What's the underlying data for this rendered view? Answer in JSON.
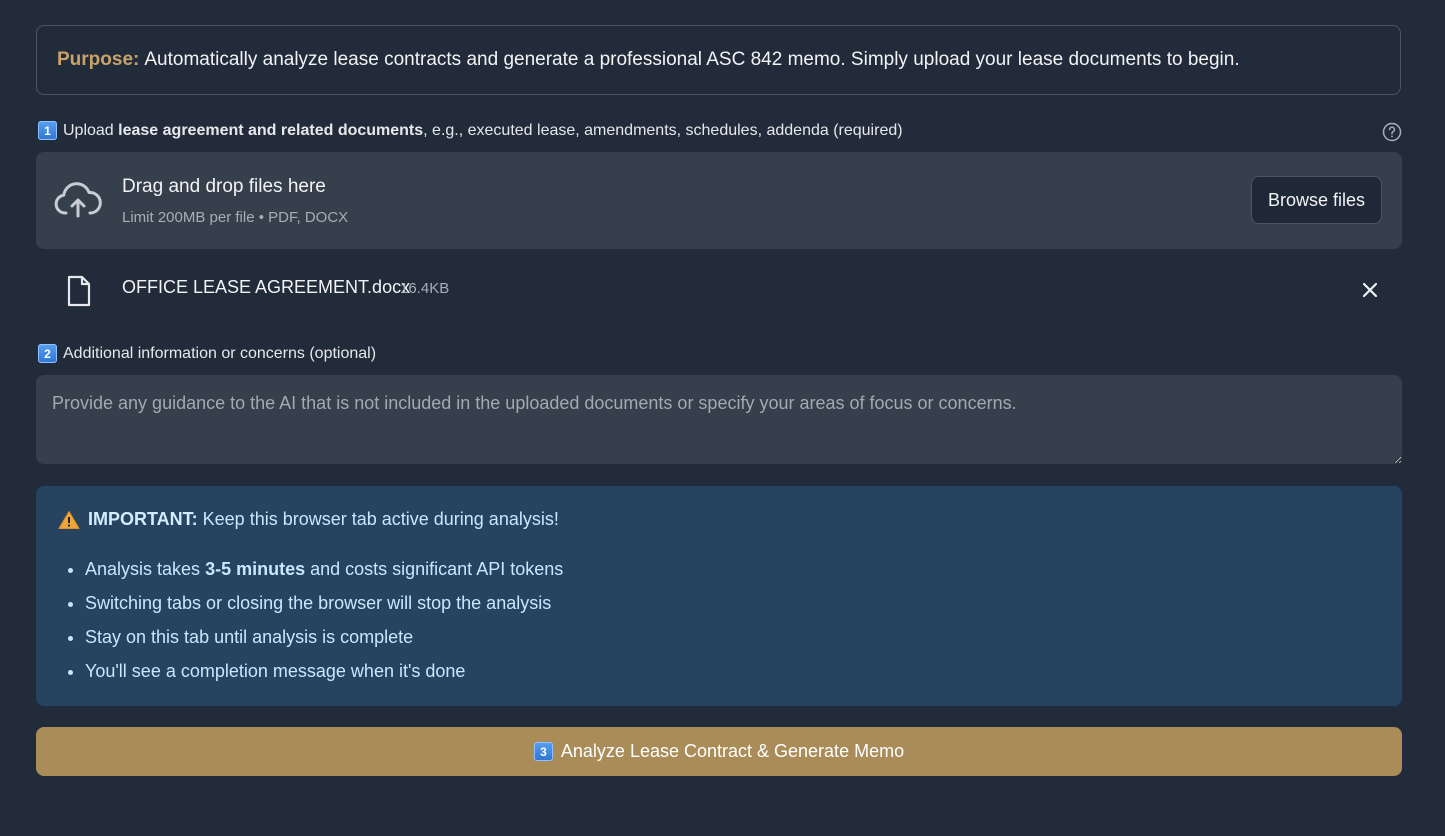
{
  "purpose": {
    "label": "Purpose:",
    "text": "Automatically analyze lease contracts and generate a professional ASC 842 memo. Simply upload your lease documents to begin."
  },
  "step1": {
    "badge": "1",
    "prefix": "Upload ",
    "bold": "lease agreement and related documents",
    "suffix": ", e.g., executed lease, amendments, schedules, addenda (required)"
  },
  "uploader": {
    "title": "Drag and drop files here",
    "subtitle": "Limit 200MB per file • PDF, DOCX",
    "browse_label": "Browse files",
    "icon": "cloud-upload-icon"
  },
  "uploaded_file": {
    "name": "OFFICE LEASE AGREEMENT.docx",
    "size": "16.4KB",
    "icon": "file-icon"
  },
  "step2": {
    "badge": "2",
    "label": "Additional information or concerns (optional)",
    "placeholder": "Provide any guidance to the AI that is not included in the uploaded documents or specify your areas of focus or concerns."
  },
  "alert": {
    "title": "IMPORTANT:",
    "message": "Keep this browser tab active during analysis!",
    "items": [
      {
        "pre": "Analysis takes ",
        "bold": "3-5 minutes",
        "post": " and costs significant API tokens"
      },
      {
        "pre": "Switching tabs or closing the browser will stop the analysis",
        "bold": "",
        "post": ""
      },
      {
        "pre": "Stay on this tab until analysis is complete",
        "bold": "",
        "post": ""
      },
      {
        "pre": "You'll see a completion message when it's done",
        "bold": "",
        "post": ""
      }
    ]
  },
  "analyze": {
    "badge": "3",
    "label": "Analyze Lease Contract & Generate Memo"
  },
  "colors": {
    "background": "#212b39",
    "accent_gold": "#a98c58",
    "purpose_label": "#c9a26a",
    "alert_bg": "#26445f",
    "input_bg": "#363f4c"
  }
}
